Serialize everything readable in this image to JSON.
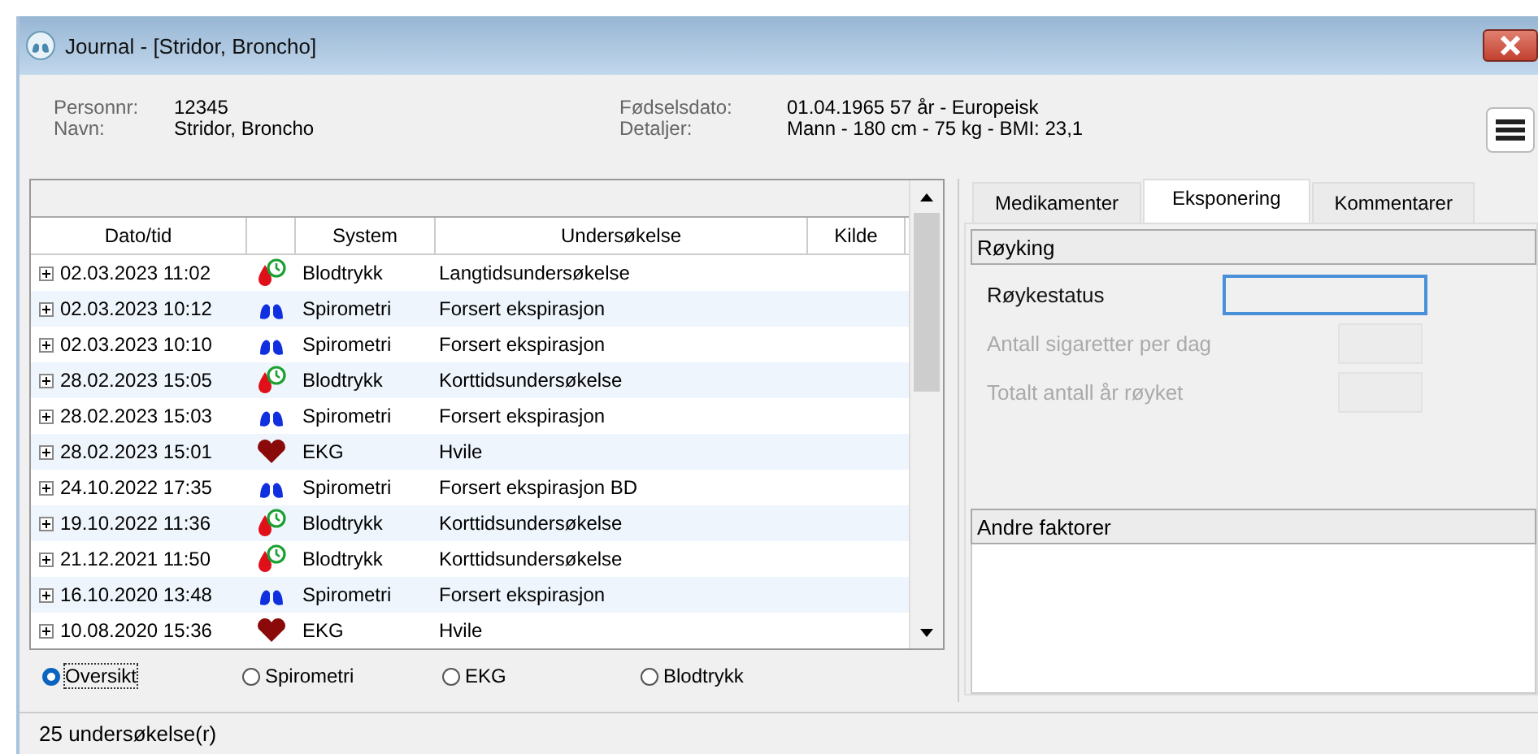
{
  "window": {
    "title": "Journal - [Stridor, Broncho]"
  },
  "patient": {
    "left": [
      {
        "label": "Personnr:",
        "value": "12345"
      },
      {
        "label": "Navn:",
        "value": "Stridor, Broncho"
      }
    ],
    "right": [
      {
        "label": "Fødselsdato:",
        "value": "01.04.1965  57 år   -   Europeisk"
      },
      {
        "label": "Detaljer:",
        "value": "Mann   -   180 cm   -   75 kg   -   BMI: 23,1"
      }
    ]
  },
  "table": {
    "columns": [
      "Dato/tid",
      "System",
      "Undersøkelse",
      "Kilde"
    ],
    "rows": [
      {
        "date": "02.03.2023 11:02",
        "kind": "bp",
        "system": "Blodtrykk",
        "exam": "Langtidsundersøkelse"
      },
      {
        "date": "02.03.2023 10:12",
        "kind": "spiro",
        "system": "Spirometri",
        "exam": "Forsert ekspirasjon"
      },
      {
        "date": "02.03.2023 10:10",
        "kind": "spiro",
        "system": "Spirometri",
        "exam": "Forsert ekspirasjon"
      },
      {
        "date": "28.02.2023 15:05",
        "kind": "bp",
        "system": "Blodtrykk",
        "exam": "Korttidsundersøkelse"
      },
      {
        "date": "28.02.2023 15:03",
        "kind": "spiro",
        "system": "Spirometri",
        "exam": "Forsert ekspirasjon"
      },
      {
        "date": "28.02.2023 15:01",
        "kind": "ekg",
        "system": "EKG",
        "exam": "Hvile"
      },
      {
        "date": "24.10.2022 17:35",
        "kind": "spiro",
        "system": "Spirometri",
        "exam": "Forsert ekspirasjon BD"
      },
      {
        "date": "19.10.2022 11:36",
        "kind": "bp",
        "system": "Blodtrykk",
        "exam": "Korttidsundersøkelse"
      },
      {
        "date": "21.12.2021 11:50",
        "kind": "bp",
        "system": "Blodtrykk",
        "exam": "Korttidsundersøkelse"
      },
      {
        "date": "16.10.2020 13:48",
        "kind": "spiro",
        "system": "Spirometri",
        "exam": "Forsert ekspirasjon"
      },
      {
        "date": "10.08.2020 15:36",
        "kind": "ekg",
        "system": "EKG",
        "exam": "Hvile"
      }
    ]
  },
  "filters": [
    {
      "label": "Oversikt",
      "selected": true
    },
    {
      "label": "Spirometri",
      "selected": false
    },
    {
      "label": "EKG",
      "selected": false
    },
    {
      "label": "Blodtrykk",
      "selected": false
    }
  ],
  "tabs": [
    {
      "label": "Medikamenter",
      "selected": false
    },
    {
      "label": "Eksponering",
      "selected": true
    },
    {
      "label": "Kommentarer",
      "selected": false
    }
  ],
  "smoking": {
    "title": "Røyking",
    "fields": [
      {
        "label": "Røykestatus",
        "disabled": false,
        "focused": true
      },
      {
        "label": "Antall sigaretter per dag",
        "disabled": true,
        "focused": false
      },
      {
        "label": "Totalt antall år røyket",
        "disabled": true,
        "focused": false
      }
    ]
  },
  "other": {
    "title": "Andre faktorer"
  },
  "status_bar": "25 undersøkelse(r)"
}
